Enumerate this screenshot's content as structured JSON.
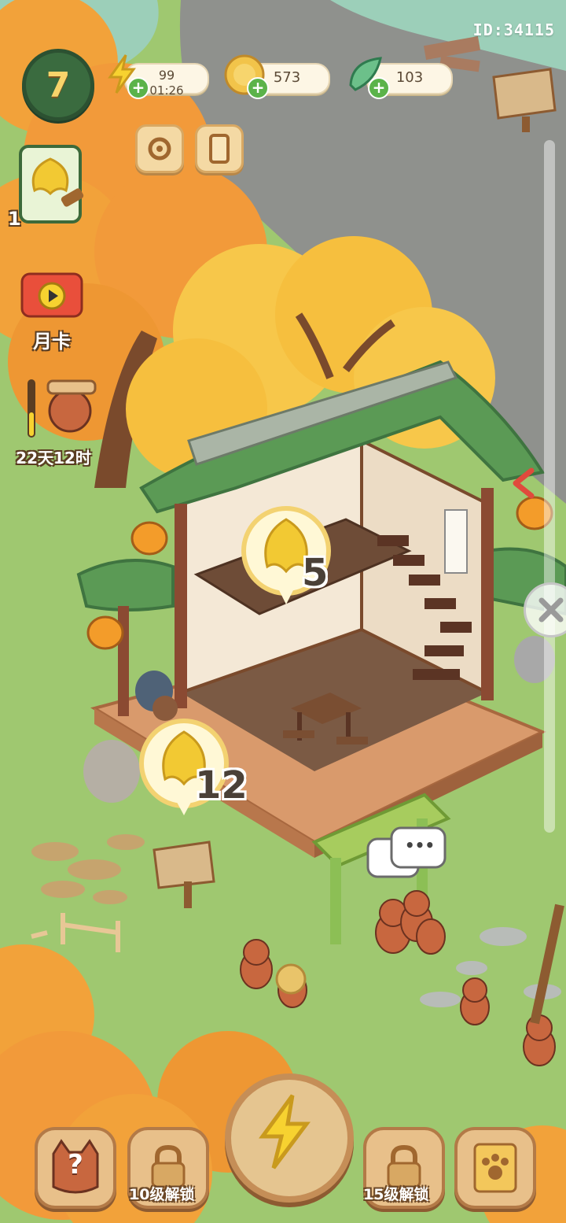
{
  "hud": {
    "player_id": "ID:34115",
    "level": "7",
    "resources": {
      "energy": {
        "value": "99",
        "timer": "01:26",
        "icon": "lightning-icon"
      },
      "coins": {
        "value": "573",
        "icon": "gold-coin-icon"
      },
      "leaves": {
        "value": "103",
        "icon": "green-leaf-icon"
      }
    },
    "plus_symbol": "+",
    "buttons": {
      "settings_icon": "gear-icon",
      "inventory_icon": "card-icon"
    }
  },
  "side_menu": {
    "quest_card_count": "1",
    "monthly_card_label": "月卡",
    "event_timer": "22天12时"
  },
  "scene": {
    "bubble_top_count": "5",
    "bubble_bottom_count": "12",
    "speech_dots": "•••"
  },
  "bottom_bar": {
    "help_symbol": "?",
    "locked_left_label": "10级解锁",
    "locked_right_label": "15级解锁",
    "center_icon": "lightning-icon",
    "right_icon": "paw-card-icon"
  },
  "colors": {
    "grass": "#9fc870",
    "autumn_orange": "#f2a23a",
    "autumn_yellow": "#f7c74a",
    "roof_green": "#5b9a55",
    "wood": "#8b5a3a",
    "stone_bg": "#8f918d",
    "water": "#9ccfb9"
  }
}
